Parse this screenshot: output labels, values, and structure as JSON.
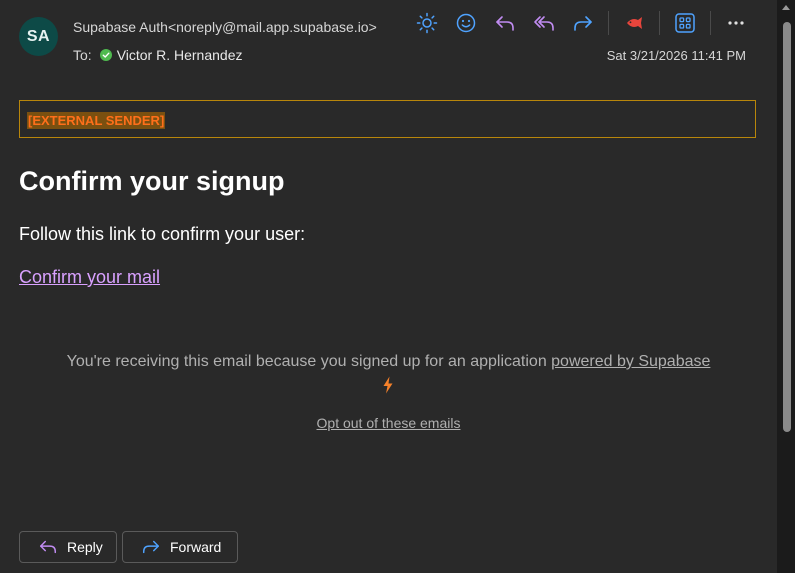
{
  "header": {
    "avatar_initials": "SA",
    "avatar_color": "#0d4a47",
    "sender": "Supabase Auth<noreply@mail.app.supabase.io>",
    "to_label": "To:",
    "recipient": "Victor R. Hernandez",
    "timestamp": "Sat 3/21/2026 11:41 PM"
  },
  "toolbar": {
    "icons": [
      "sun-icon",
      "emoji-icon",
      "reply-icon",
      "reply-all-icon",
      "forward-icon",
      "fish-icon",
      "apps-icon",
      "more-icon"
    ],
    "accent_blue": "#4fa3ff",
    "accent_purple": "#c18cf2",
    "accent_red": "#e8453c"
  },
  "message": {
    "banner": "[EXTERNAL SENDER]",
    "heading": "Confirm your signup",
    "instruction": "Follow this link to confirm your user:",
    "confirm_link": "Confirm your mail",
    "footer_text": "You're receiving this email because you signed up for an application ",
    "footer_link": "powered by Supabase",
    "opt_out": "Opt out of these emails",
    "link_color": "#d9a1ff",
    "banner_color": "#ff6f1a"
  },
  "actions": {
    "reply_label": "Reply",
    "forward_label": "Forward"
  }
}
